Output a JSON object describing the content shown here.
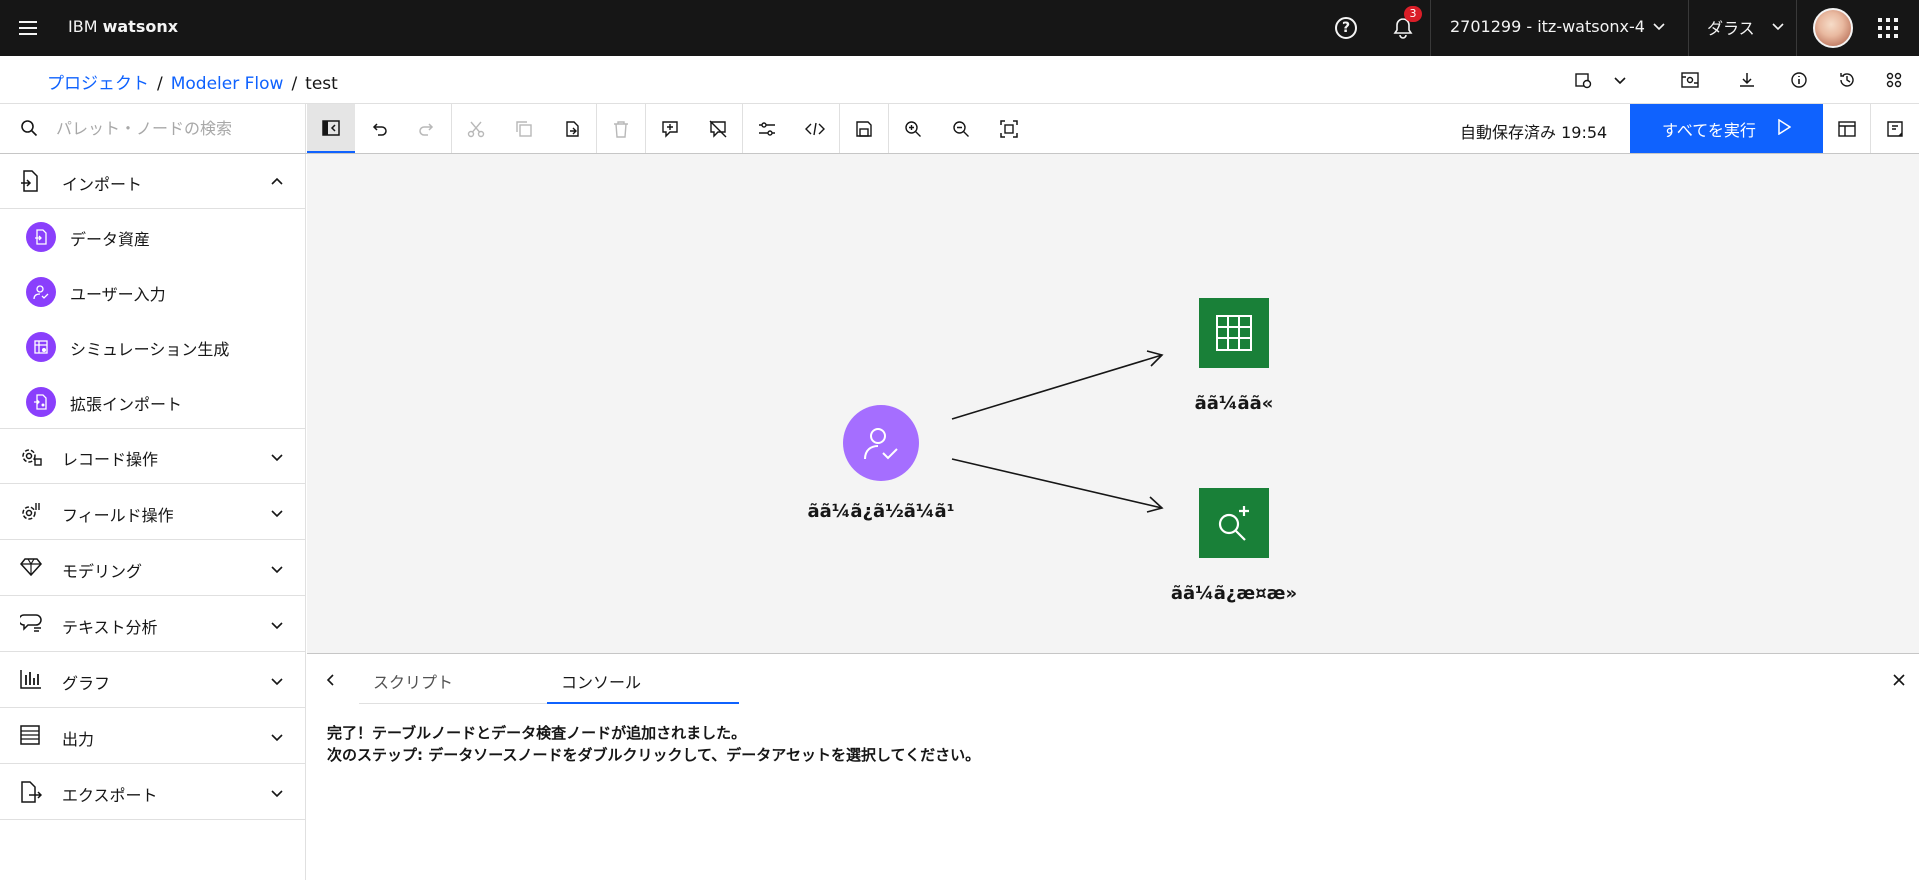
{
  "header": {
    "brand_prefix": "IBM",
    "brand_name": "watsonx",
    "notification_count": "3",
    "account": "2701299 - itz-watsonx-4",
    "region": "ダラス"
  },
  "breadcrumb": {
    "items": [
      "プロジェクト",
      "Modeler Flow",
      "test"
    ]
  },
  "search": {
    "placeholder": "パレット・ノードの検索"
  },
  "toolbar": {
    "autosave": "自動保存済み 19:54",
    "run_all": "すべてを実行"
  },
  "palette": {
    "import": {
      "label": "インポート"
    },
    "import_nodes": [
      {
        "label": "データ資産",
        "icon": "data-asset-icon"
      },
      {
        "label": "ユーザー入力",
        "icon": "user-input-icon"
      },
      {
        "label": "シミュレーション生成",
        "icon": "simulation-icon"
      },
      {
        "label": "拡張インポート",
        "icon": "extension-import-icon"
      }
    ],
    "categories": [
      {
        "label": "レコード操作",
        "icon": "record-ops-icon"
      },
      {
        "label": "フィールド操作",
        "icon": "field-ops-icon"
      },
      {
        "label": "モデリング",
        "icon": "modeling-icon"
      },
      {
        "label": "テキスト分析",
        "icon": "text-analytics-icon"
      },
      {
        "label": "グラフ",
        "icon": "graph-icon"
      },
      {
        "label": "出力",
        "icon": "output-icon"
      },
      {
        "label": "エクスポート",
        "icon": "export-icon"
      }
    ]
  },
  "canvas": {
    "nodes": [
      {
        "label": "ãã¼ã¿ã½ã¼ã¹",
        "icon": "user-input-icon",
        "color": "#a56eff"
      },
      {
        "label": "ãã¼ãã«",
        "icon": "table-icon",
        "color": "#198038"
      },
      {
        "label": "ãã¼ã¿æ¤æ»",
        "icon": "data-audit-icon",
        "color": "#198038"
      }
    ]
  },
  "bottom_panel": {
    "tabs": [
      "スクリプト",
      "コンソール"
    ],
    "active_tab": "コンソール",
    "console_lines": [
      "完了！テーブルノードとデータ検査ノードが追加されました。",
      "次のステップ: データソースノードをダブルクリックして、データアセットを選択してください。"
    ]
  },
  "colors": {
    "accent": "#0f62fe",
    "header_bg": "#161616",
    "source_node": "#a56eff",
    "palette_node": "#8a3ffc",
    "output_node": "#198038",
    "badge": "#da1e28"
  }
}
